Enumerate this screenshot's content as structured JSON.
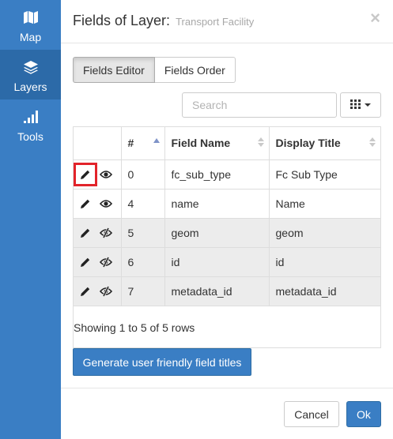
{
  "sidebar": {
    "items": [
      {
        "label": "Map",
        "icon": "map-icon"
      },
      {
        "label": "Layers",
        "icon": "layers-icon",
        "active": true
      },
      {
        "label": "Tools",
        "icon": "signal-bars-icon"
      }
    ]
  },
  "dialog": {
    "title": "Fields of Layer:",
    "subtitle": "Transport Facility",
    "close_label": "×",
    "tabs": [
      {
        "label": "Fields Editor",
        "active": true
      },
      {
        "label": "Fields Order",
        "active": false
      }
    ],
    "search": {
      "placeholder": "Search",
      "value": ""
    },
    "table": {
      "headers": [
        "",
        "#",
        "Field Name",
        "Display Title"
      ],
      "rows": [
        {
          "num": "0",
          "field_name": "fc_sub_type",
          "display_title": "Fc Sub Type",
          "visible": true
        },
        {
          "num": "4",
          "field_name": "name",
          "display_title": "Name",
          "visible": true
        },
        {
          "num": "5",
          "field_name": "geom",
          "display_title": "geom",
          "visible": false
        },
        {
          "num": "6",
          "field_name": "id",
          "display_title": "id",
          "visible": false
        },
        {
          "num": "7",
          "field_name": "metadata_id",
          "display_title": "metadata_id",
          "visible": false
        }
      ]
    },
    "pagination_text": "Showing 1 to 5 of 5 rows",
    "generate_button": "Generate user friendly field titles",
    "cancel_button": "Cancel",
    "ok_button": "Ok"
  },
  "colors": {
    "primary": "#3a7ec4",
    "sidebar_active": "#2c6aa8",
    "highlight": "#e2232a"
  }
}
